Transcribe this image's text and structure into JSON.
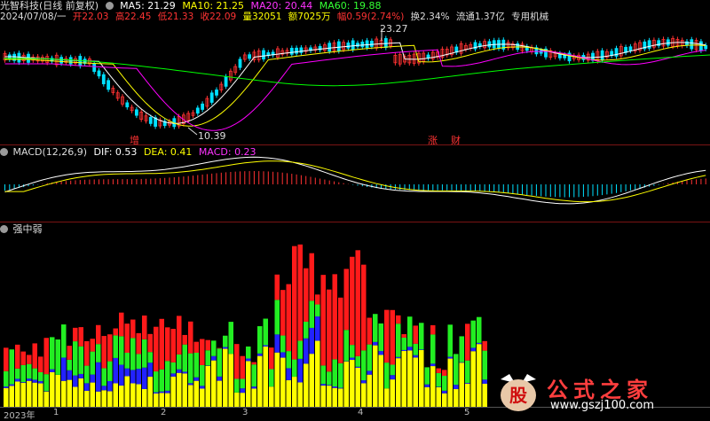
{
  "header": {
    "stock_name": "光智科技(日线 前复权)",
    "ma5": "MA5: 21.29",
    "ma10": "MA10: 21.25",
    "ma20": "MA20: 20.44",
    "ma60": "MA60: 19.88"
  },
  "info_line": {
    "date": "2024/07/08/一",
    "open": "开22.03",
    "high": "高22.45",
    "low": "低21.33",
    "close": "收22.09",
    "volume": "量32051",
    "amount": "额7025万",
    "change": "幅0.59(2.74%)",
    "turnover": "换2.34%",
    "float_cap": "流通1.37亿",
    "industry": "专用机械"
  },
  "price_annotations": {
    "high_label": "23.27",
    "low_label": "10.39",
    "signal_left": "增",
    "signal_right_1": "涨",
    "signal_right_2": "财"
  },
  "macd": {
    "title": "MACD(12,26,9)",
    "dif": "DIF: 0.53",
    "dea": "DEA: 0.41",
    "macd": "MACD: 0.23"
  },
  "indicator": {
    "title": "强中弱"
  },
  "xaxis": {
    "year_label": "2023年",
    "ticks": [
      "1",
      "2",
      "3",
      "4",
      "5"
    ]
  },
  "watermark": {
    "logo_char": "股",
    "brand": "公式之家",
    "url": "www.gszj100.com"
  },
  "colors": {
    "up": "#ff3232",
    "down": "#00e0ff",
    "ma5": "#ffffff",
    "ma10": "#ffff00",
    "ma20": "#ff00ff",
    "ma60": "#00ff00",
    "bar_red": "#ff1a1a",
    "bar_green": "#22ee22",
    "bar_yellow": "#ffff00",
    "bar_blue": "#2222ff"
  }
}
